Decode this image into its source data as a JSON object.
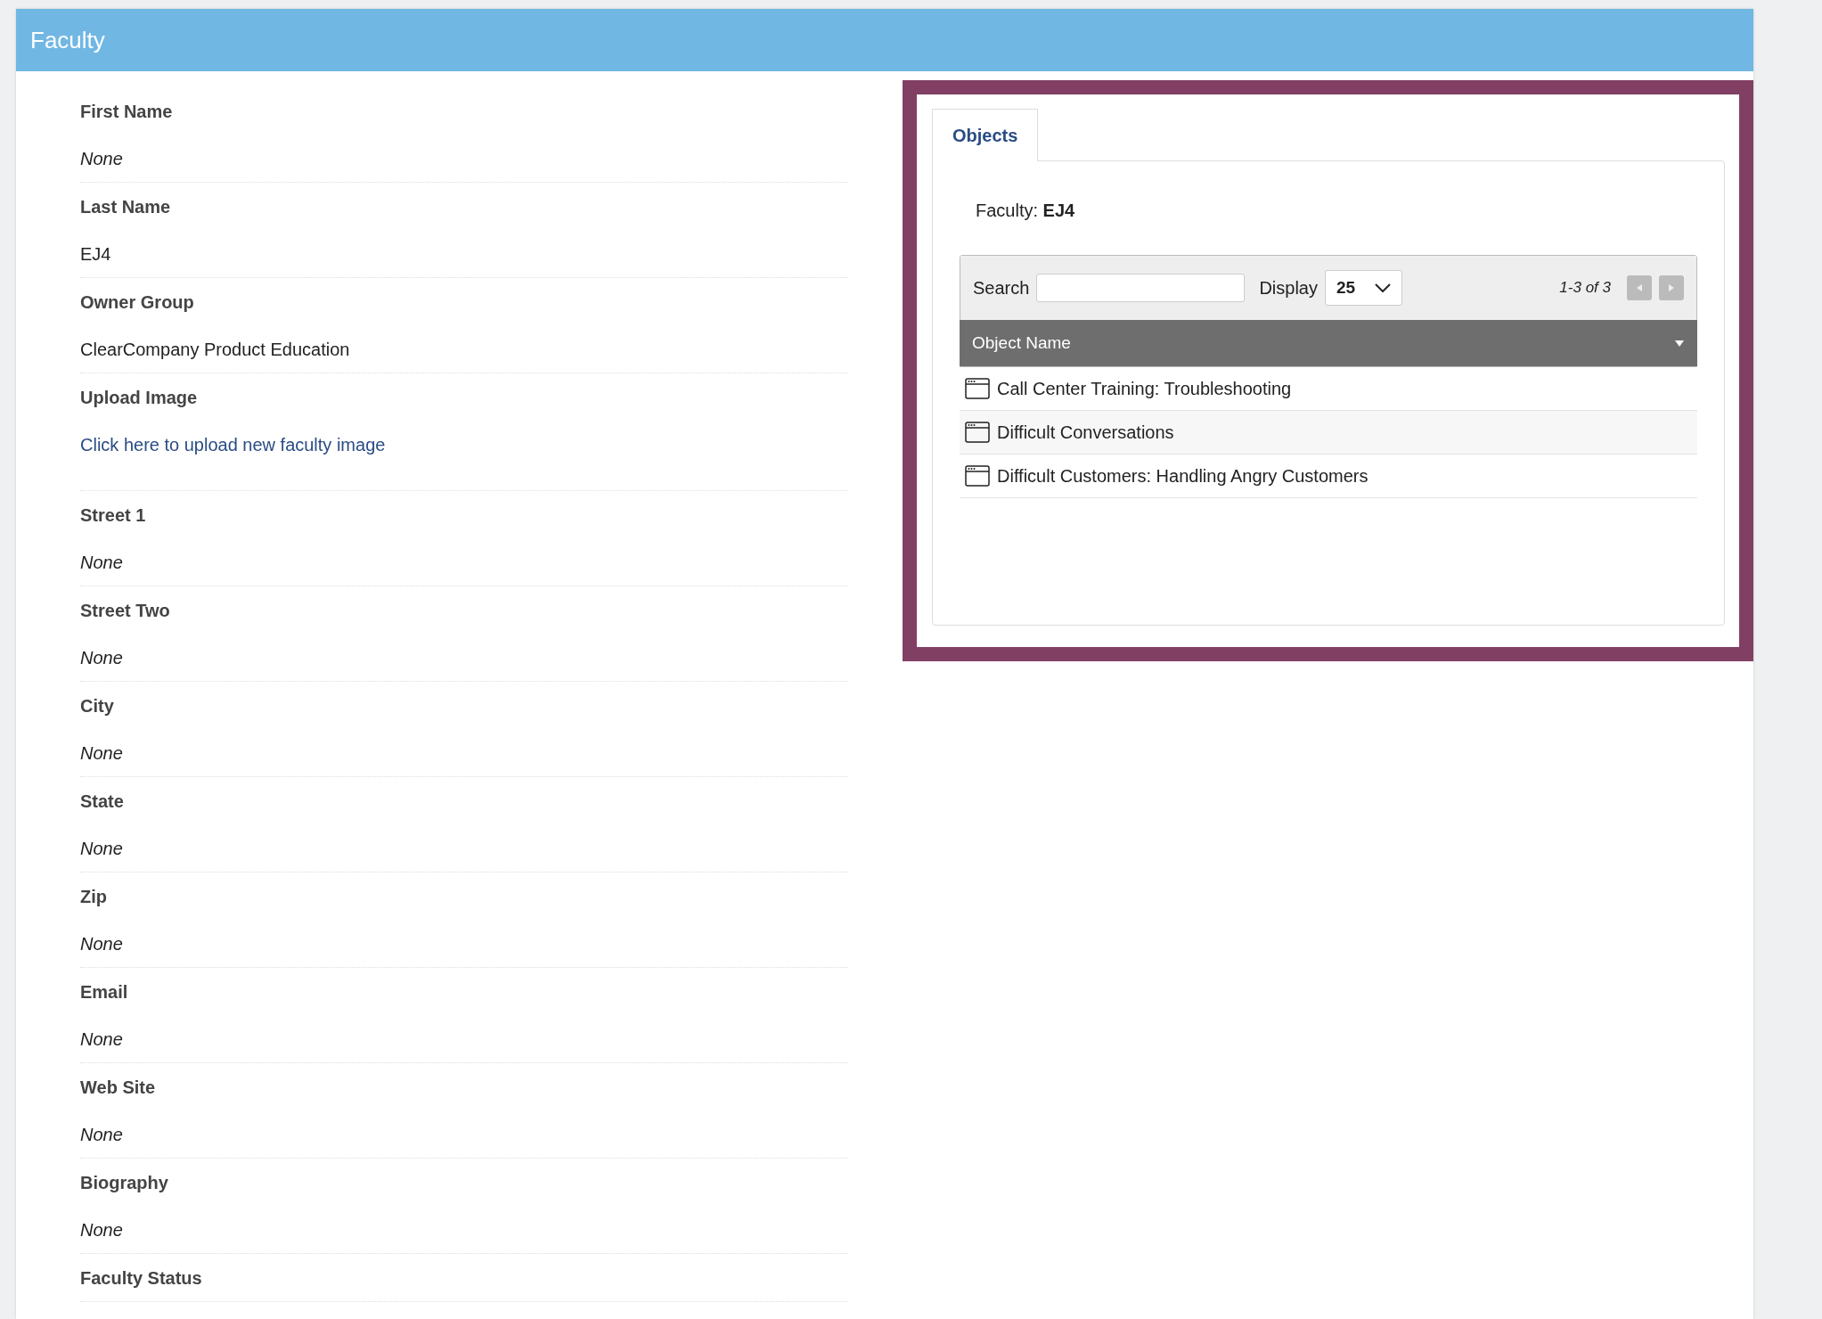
{
  "header": {
    "title": "Faculty"
  },
  "fields": [
    {
      "label": "First Name",
      "value": "None",
      "kind": "empty"
    },
    {
      "label": "Last Name",
      "value": "EJ4",
      "kind": "text"
    },
    {
      "label": "Owner Group",
      "value": "ClearCompany Product Education",
      "kind": "text"
    },
    {
      "label": "Upload Image",
      "value": "Click here to upload new faculty image",
      "kind": "link"
    },
    {
      "label": "Street 1",
      "value": "None",
      "kind": "empty"
    },
    {
      "label": "Street Two",
      "value": "None",
      "kind": "empty"
    },
    {
      "label": "City",
      "value": "None",
      "kind": "empty"
    },
    {
      "label": "State",
      "value": "None",
      "kind": "empty"
    },
    {
      "label": "Zip",
      "value": "None",
      "kind": "empty"
    },
    {
      "label": "Email",
      "value": "None",
      "kind": "empty"
    },
    {
      "label": "Web Site",
      "value": "None",
      "kind": "empty"
    },
    {
      "label": "Biography",
      "value": "None",
      "kind": "empty"
    },
    {
      "label": "Faculty Status"
    }
  ],
  "objects_panel": {
    "tabs": [
      {
        "label": "Objects",
        "selected": true
      }
    ],
    "caption": "Faculty: **EJ4**",
    "search_label": "Search",
    "display_label": "Display",
    "display_value": "25",
    "pager": "1-3 of 3",
    "column": "Object Name",
    "rows": [
      {
        "name": "Call Center Training: Troubleshooting"
      },
      {
        "name": "Difficult Conversations"
      },
      {
        "name": "Difficult Customers: Handling Angry Customers"
      }
    ]
  }
}
